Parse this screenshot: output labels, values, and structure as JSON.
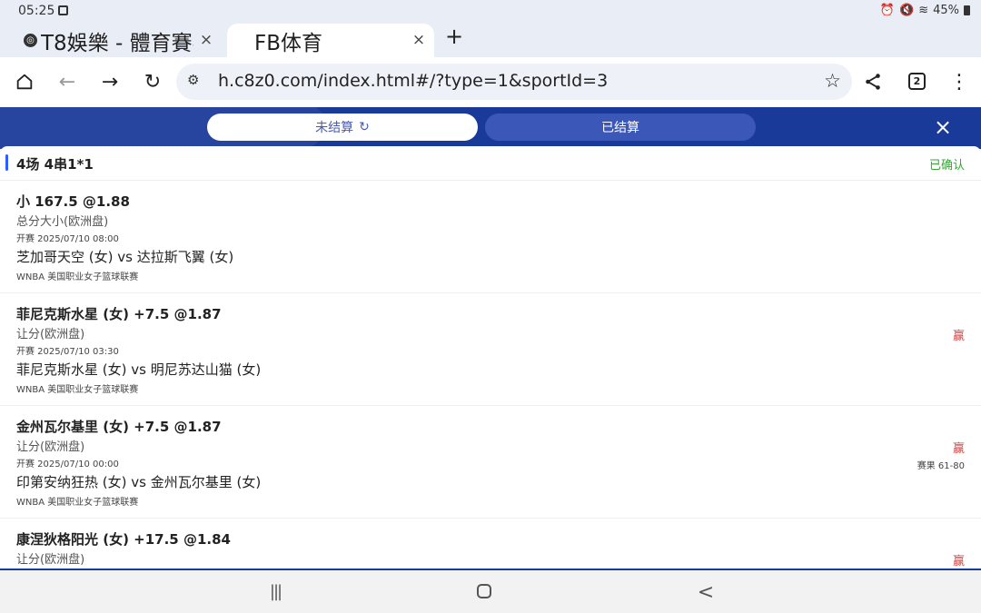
{
  "status_bar": {
    "time": "05:25",
    "battery": "45%"
  },
  "tabs": [
    {
      "title": "T8娛樂 - 體育賽事",
      "close": "×"
    },
    {
      "title": "FB体育",
      "close": "×"
    }
  ],
  "new_tab_label": "+",
  "address_bar": {
    "url": "h.c8z0.com/index.html#/?type=1&sportId=3",
    "tab_count": "2"
  },
  "app_header": {
    "tabs": [
      {
        "label": "未结算"
      },
      {
        "label": "已结算"
      }
    ],
    "close": "×"
  },
  "summary": {
    "title": "4场 4串1*1",
    "status": "已确认"
  },
  "bets": [
    {
      "selection": "小 167.5 @1.88",
      "market": "总分大小(欧洲盘)",
      "start": "开赛  2025/07/10 08:00",
      "match": "芝加哥天空 (女) vs 达拉斯飞翼 (女)",
      "league": "WNBA 美国职业女子篮球联赛",
      "result": "",
      "score": ""
    },
    {
      "selection": "菲尼克斯水星 (女) +7.5 @1.87",
      "market": "让分(欧洲盘)",
      "start": "开赛  2025/07/10 03:30",
      "match": "菲尼克斯水星 (女) vs 明尼苏达山猫 (女)",
      "league": "WNBA 美国职业女子篮球联赛",
      "result": "赢",
      "score": ""
    },
    {
      "selection": "金州瓦尔基里 (女) +7.5 @1.87",
      "market": "让分(欧洲盘)",
      "start": "开赛  2025/07/10 00:00",
      "match": "印第安纳狂热 (女) vs 金州瓦尔基里 (女)",
      "league": "WNBA 美国职业女子篮球联赛",
      "result": "赢",
      "score": "赛果  61-80"
    },
    {
      "selection": "康涅狄格阳光 (女) +17.5 @1.84",
      "market": "让分(欧洲盘)",
      "start": "",
      "match": "",
      "league": "",
      "result": "赢",
      "score": ""
    }
  ],
  "colors": {
    "header_blue": "#1a3a9a",
    "win_red": "#d24545",
    "confirmed_green": "#3aa23a",
    "accent": "#2f5bff"
  }
}
